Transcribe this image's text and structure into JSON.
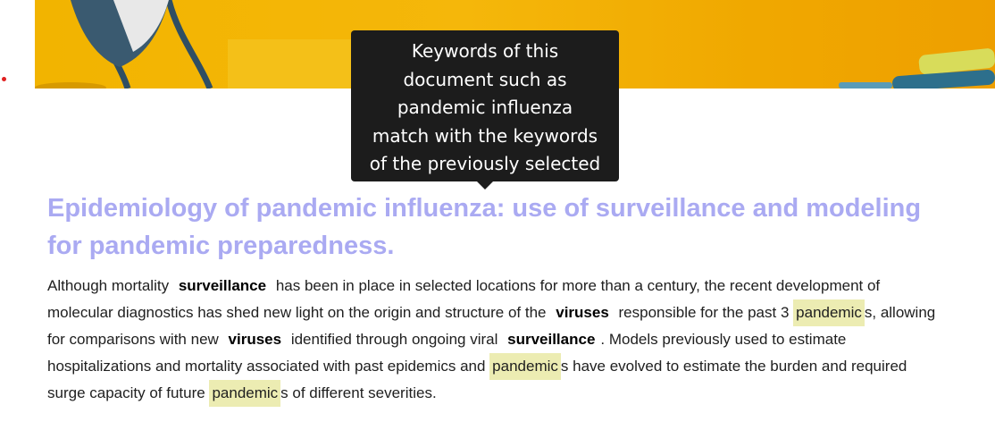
{
  "tooltip": {
    "text": "Keywords of this document such as pandemic influenza match with the keywords of the previously selected documents."
  },
  "document": {
    "title": "Epidemiology of pandemic influenza: use of surveillance and modeling for pandemic preparedness.",
    "abstract": {
      "t1": "Although mortality",
      "k1": "surveillance",
      "t2": "has been in place in selected locations for more than a century, the recent development of molecular diagnostics has shed new light on the origin and structure of the",
      "k2": "viruses",
      "t3": "responsible for the past 3",
      "h1": "pandemic",
      "t4": "s, allowing for comparisons with new",
      "k3": "viruses",
      "t5": "identified through ongoing viral",
      "k4": "surveillance",
      "t6": ". Models previously used to estimate hospitalizations and mortality associated with past epidemics and",
      "h2": "pandemic",
      "t7": "s have evolved to estimate the burden and required surge capacity of future",
      "h3": "pandemic",
      "t8": "s of different severities."
    }
  },
  "colors": {
    "title": "#aaaaf2",
    "highlight": "#ececb2",
    "tooltip_bg": "#1c1c1c",
    "banner": "#f2b400"
  }
}
